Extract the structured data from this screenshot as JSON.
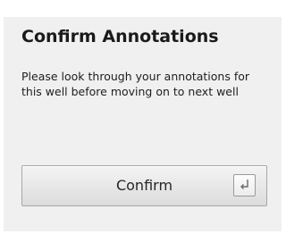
{
  "dialog": {
    "title": "Confirm Annotations",
    "message": "Please look through your annotations for this well before moving on to next well",
    "confirm_label": "Confirm",
    "shortcut_icon": "enter-key-icon"
  },
  "colors": {
    "panel_background": "#f0f0f0",
    "button_border": "#a7a7a7"
  }
}
